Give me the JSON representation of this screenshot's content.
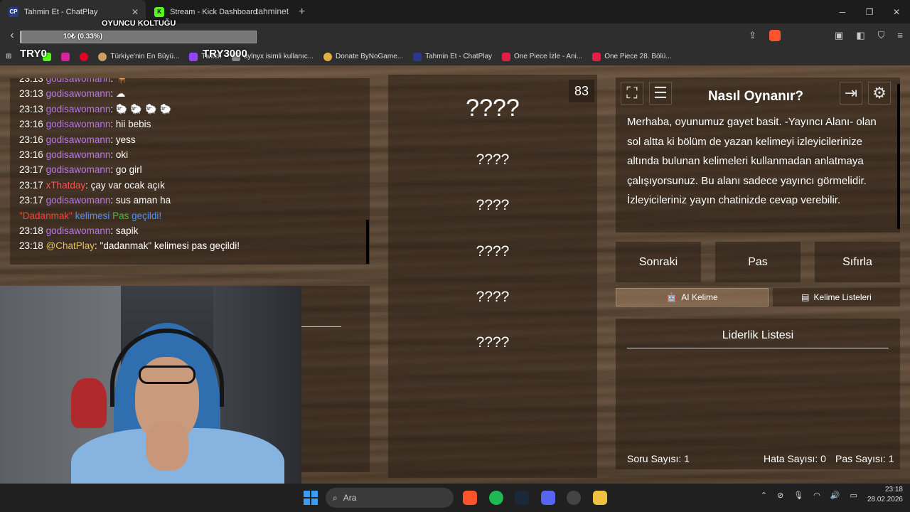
{
  "browser": {
    "tabs": [
      {
        "label": "Tahmin Et - ChatPlay",
        "favicon": "CP",
        "active": true
      },
      {
        "label": "Stream - Kick Dashboard",
        "favicon": "K",
        "active": false
      }
    ],
    "url": "tahminet",
    "bookmarks": [
      "Türkiye'nin En Büyü...",
      "Twitch",
      "aylnyx isimli kullanıc...",
      "Donate ByNoGame...",
      "Tahmin Et - ChatPlay",
      "One Piece İzle - Ani...",
      "One Piece 28. Bölü..."
    ]
  },
  "overlay": {
    "title": "OYUNCU KOLTUĞU",
    "progress_text": "10₺ (0.33%)",
    "progress_fraction": 0.0033,
    "try_left": "TRY0",
    "try_right": "TRY3000"
  },
  "chat": {
    "lines": [
      {
        "time": "23:13",
        "user": "godisawomann",
        "msg": ": 🪑",
        "type": "user"
      },
      {
        "time": "23:13",
        "user": "godisawomann",
        "msg": ": ☁",
        "type": "user"
      },
      {
        "time": "23:13",
        "user": "godisawomann",
        "msg": ": 🐑 🐑 🐑 🐑",
        "type": "user"
      },
      {
        "time": "23:16",
        "user": "godisawomann",
        "msg": ": hii bebis",
        "type": "user"
      },
      {
        "time": "23:16",
        "user": "godisawomann",
        "msg": ": yess",
        "type": "user"
      },
      {
        "time": "23:16",
        "user": "godisawomann",
        "msg": ": oki",
        "type": "user"
      },
      {
        "time": "23:17",
        "user": "godisawomann",
        "msg": ": go girl",
        "type": "user"
      },
      {
        "time": "23:17",
        "user": "xThatday",
        "msg": ": çay var ocak açık",
        "type": "user-red"
      },
      {
        "time": "23:17",
        "user": "godisawomann",
        "msg": ": sus aman ha",
        "type": "user"
      },
      {
        "system_word": "\"Dadanmak\"",
        "system_mid": " kelimesi ",
        "system_pas": "Pas",
        "system_end": " geçildi!",
        "type": "system"
      },
      {
        "time": "23:18",
        "user": "godisawomann",
        "msg": ": sapik",
        "type": "user"
      },
      {
        "time": "23:18",
        "user": "@ChatPlay",
        "msg": ": \"dadanmak\" kelimesi pas geçildi!",
        "type": "bot"
      }
    ]
  },
  "game": {
    "timer": "83",
    "words": [
      "????",
      "????",
      "????",
      "????",
      "????",
      "????"
    ]
  },
  "info": {
    "title": "Nasıl Oynanır?",
    "body": "Merhaba, oyunumuz gayet basit. -Yayıncı Alanı- olan sol altta ki bölüm de yazan kelimeyi izleyicilerinize altında bulunan kelimeleri kullanmadan anlatmaya çalışıyorsunuz. Bu alanı sadece yayıncı görmelidir. İzleyicileriniz yayın chatinizde cevap verebilir."
  },
  "actions": {
    "next": "Sonraki",
    "pass": "Pas",
    "reset": "Sıfırla"
  },
  "subtabs": {
    "ai": "AI Kelime",
    "lists": "Kelime Listeleri"
  },
  "leaderboard": {
    "title": "Liderlik Listesi",
    "question_count": "Soru Sayısı: 1",
    "error_count": "Hata Sayısı: 0",
    "pass_count": "Pas Sayısı: 1"
  },
  "taskbar": {
    "search_placeholder": "Ara",
    "time": "23:18",
    "date": "28.02.2026"
  }
}
